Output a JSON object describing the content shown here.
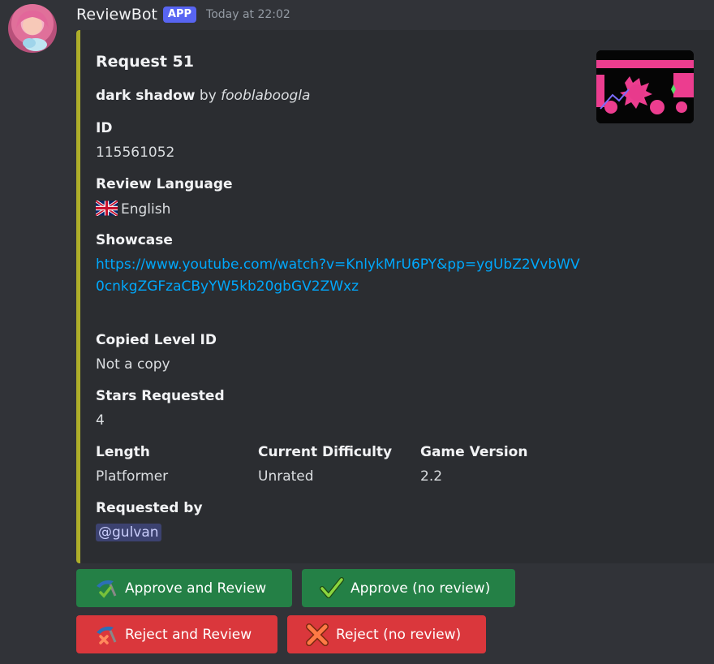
{
  "message": {
    "username": "ReviewBot",
    "badge": "APP",
    "timestamp": "Today at 22:02"
  },
  "embed": {
    "title": "Request 51",
    "level_name": "dark shadow",
    "by_word": "by",
    "author": "fooblaboogla",
    "accent_color": "#aeae2a",
    "fields": {
      "id": {
        "name": "ID",
        "value": "115561052"
      },
      "review_language": {
        "name": "Review Language",
        "value": "English",
        "flag": "uk-flag-icon"
      },
      "showcase": {
        "name": "Showcase",
        "value": "https://www.youtube.com/watch?v=KnlykMrU6PY&pp=ygUbZ2VvbWV0cnkgZGFzaCByYW5kb20gbGV2ZWxz"
      },
      "copied_level_id": {
        "name": "Copied Level ID",
        "value": "Not a copy"
      },
      "stars_requested": {
        "name": "Stars Requested",
        "value": "4"
      },
      "length": {
        "name": "Length",
        "value": "Platformer"
      },
      "current_difficulty": {
        "name": "Current Difficulty",
        "value": "Unrated"
      },
      "game_version": {
        "name": "Game Version",
        "value": "2.2"
      },
      "requested_by": {
        "name": "Requested by",
        "value": "@gulvan"
      }
    }
  },
  "buttons": [
    {
      "label": "Approve and Review",
      "icon": "check-pencil-icon",
      "color": "#248046"
    },
    {
      "label": "Approve (no review)",
      "icon": "checkmark-icon",
      "color": "#248046"
    },
    {
      "label": "Reject and Review",
      "icon": "x-pencil-icon",
      "color": "#da373c"
    },
    {
      "label": "Reject (no review)",
      "icon": "cross-mark-icon",
      "color": "#da373c"
    }
  ]
}
